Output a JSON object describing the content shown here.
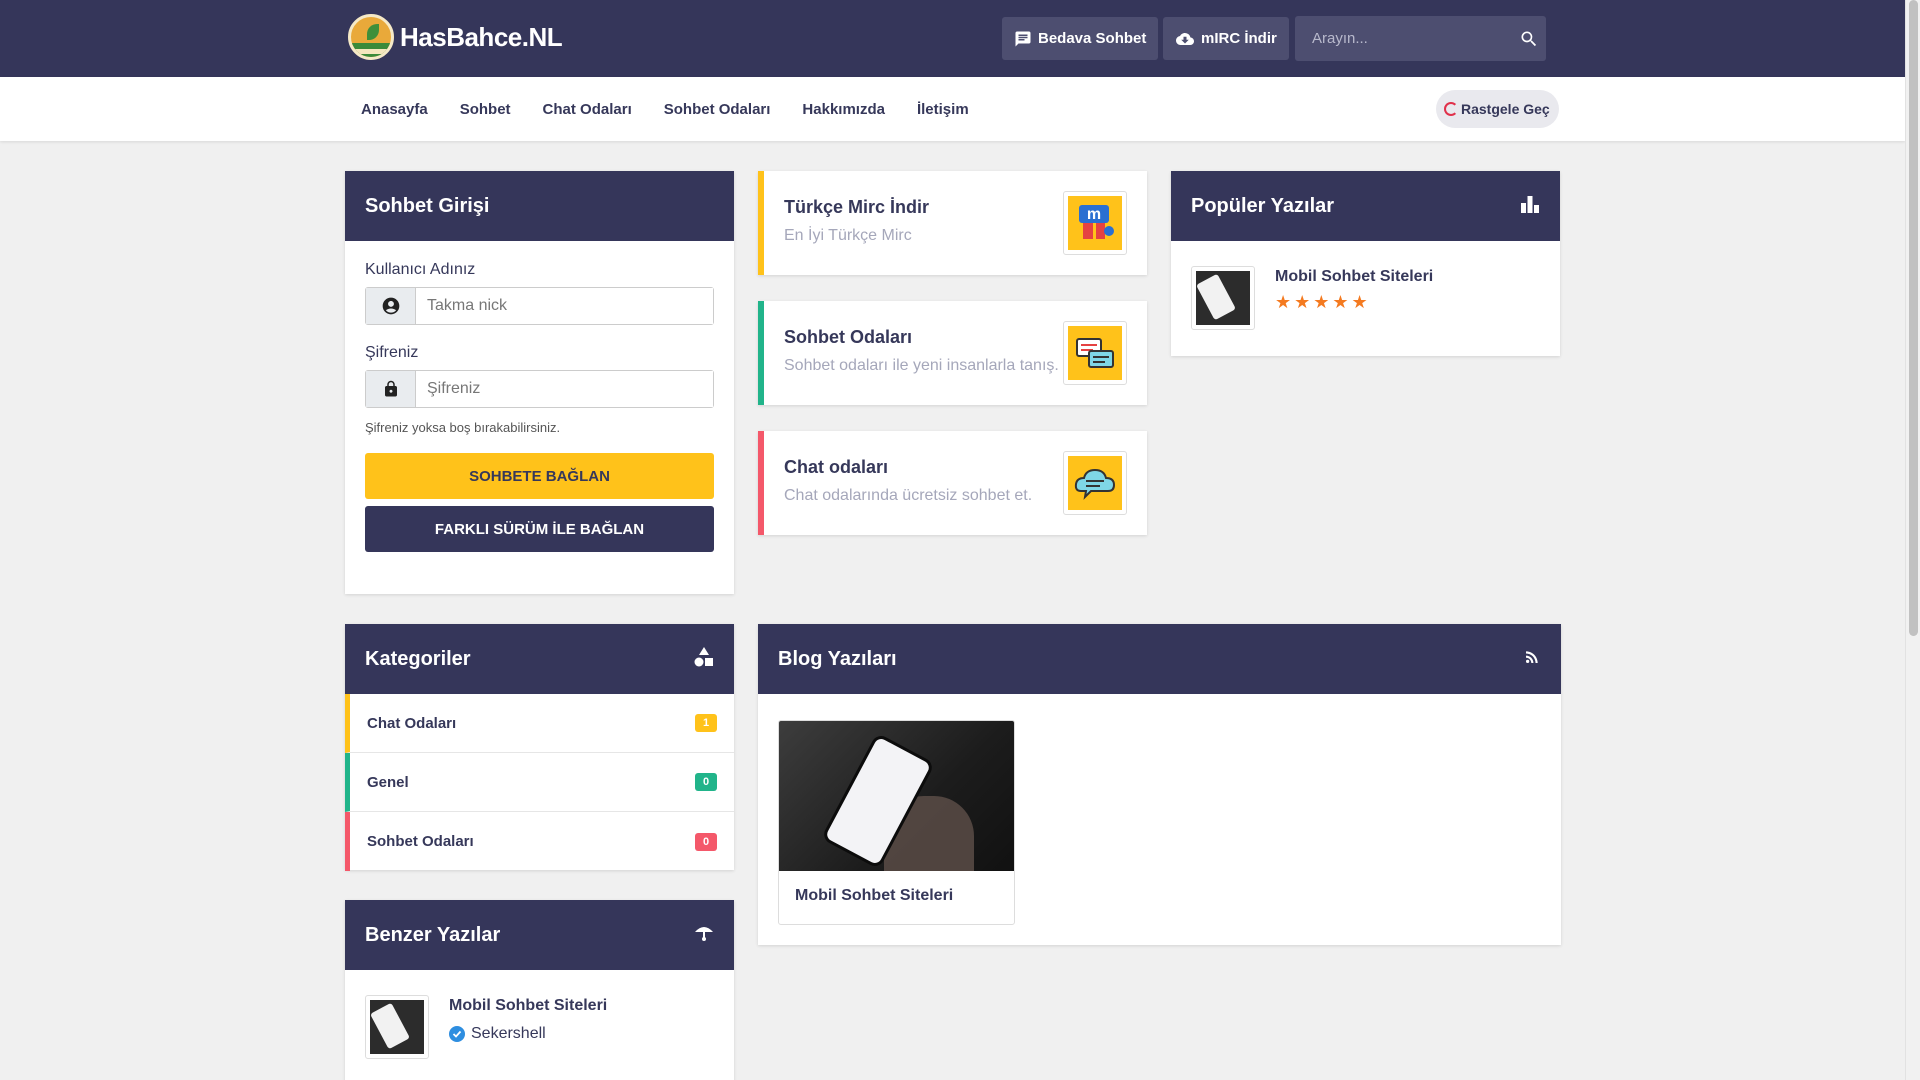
{
  "header": {
    "logo_text": "HasBahce.NL",
    "free_chat_label": "Bedava Sohbet",
    "mirc_label": "mIRC İndir",
    "search_placeholder": "Arayın..."
  },
  "nav": {
    "items": [
      "Anasayfa",
      "Sohbet",
      "Chat Odaları",
      "Sohbet Odaları",
      "Hakkımızda",
      "İletişim"
    ],
    "random_label": "Rastgele Geç"
  },
  "login": {
    "title": "Sohbet Girişi",
    "username_label": "Kullanıcı Adınız",
    "username_placeholder": "Takma nick",
    "password_label": "Şifreniz",
    "password_placeholder": "Şifreniz",
    "hint": "Şifreniz yoksa boş bırakabilirsiniz.",
    "connect_button": "SOHBETE BAĞLAN",
    "alt_connect_button": "FARKLI SÜRÜM İLE BAĞLAN"
  },
  "features": [
    {
      "title": "Türkçe Mirc İndir",
      "subtitle": "En İyi Türkçe Mirc",
      "color": "#ffc21a"
    },
    {
      "title": "Sohbet Odaları",
      "subtitle": "Sohbet odaları ile yeni insanlarla tanış.",
      "color": "#21b48a"
    },
    {
      "title": "Chat odaları",
      "subtitle": "Chat odalarında ücretsiz sohbet et.",
      "color": "#f4586a"
    }
  ],
  "popular": {
    "title": "Popüler Yazılar",
    "items": [
      {
        "title": "Mobil Sohbet Siteleri",
        "stars": "★★★★★"
      }
    ]
  },
  "categories": {
    "title": "Kategoriler",
    "items": [
      {
        "label": "Chat Odaları",
        "count": "1",
        "color": "#ffc21a"
      },
      {
        "label": "Genel",
        "count": "0",
        "color": "#21b48a"
      },
      {
        "label": "Sohbet Odaları",
        "count": "0",
        "color": "#f4586a"
      }
    ]
  },
  "blog": {
    "title": "Blog Yazıları",
    "items": [
      {
        "title": "Mobil Sohbet Siteleri"
      }
    ]
  },
  "similar": {
    "title": "Benzer Yazılar",
    "items": [
      {
        "title": "Mobil Sohbet Siteleri",
        "author": "Sekershell"
      }
    ]
  }
}
